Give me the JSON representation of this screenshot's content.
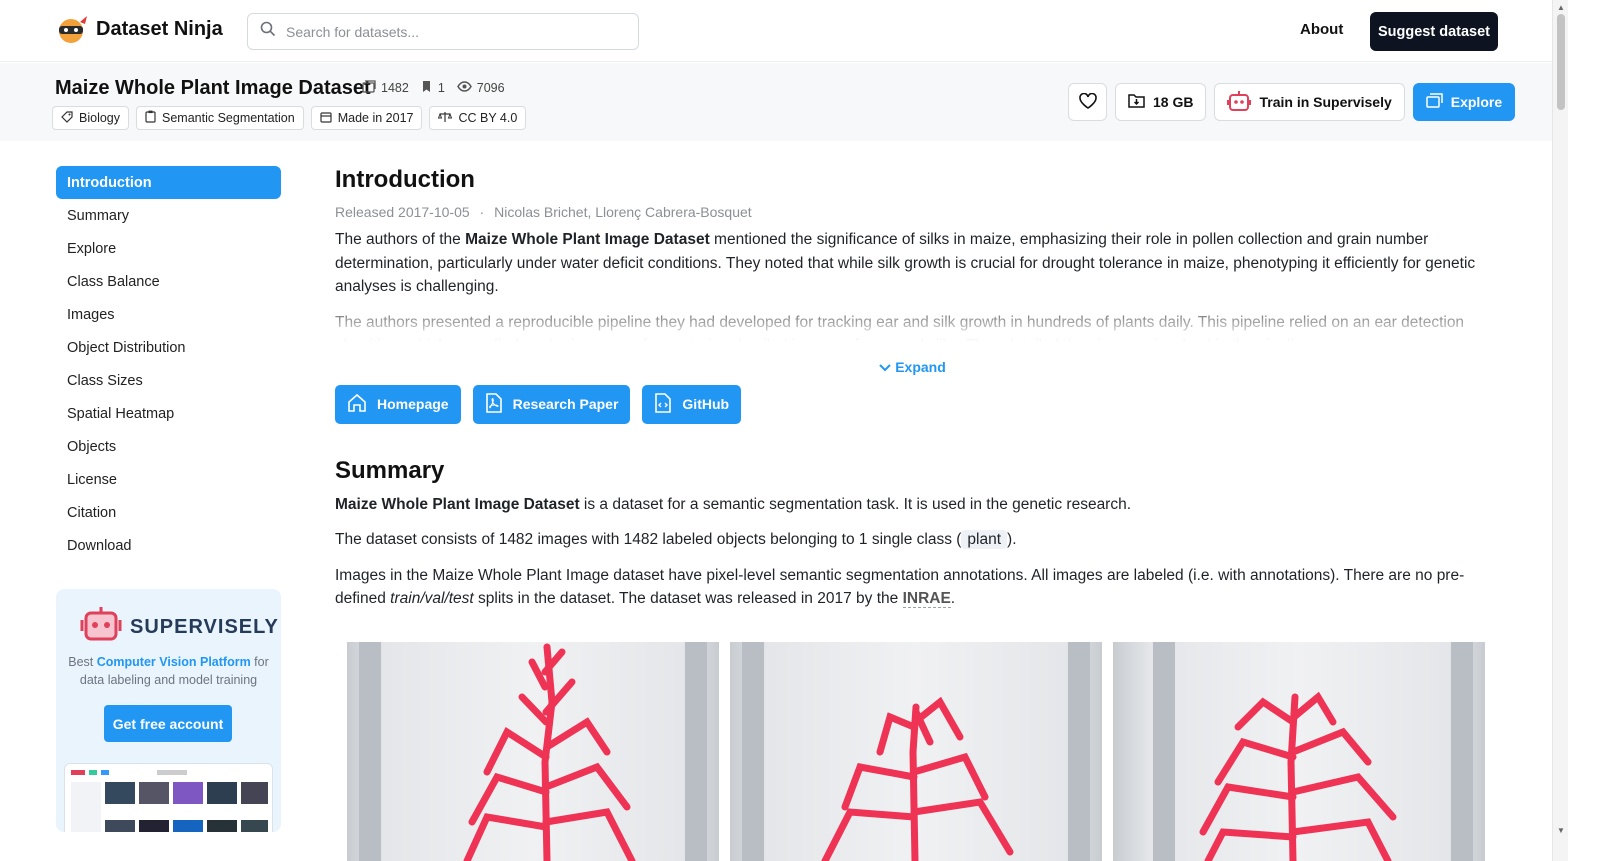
{
  "nav": {
    "logo_text": "Dataset Ninja",
    "search_placeholder": "Search for datasets...",
    "about": "About",
    "suggest": "Suggest dataset"
  },
  "dataset": {
    "title": "Maize Whole Plant Image Dataset",
    "images_count": "1482",
    "classes_count": "1",
    "views_count": "7096",
    "tags": [
      {
        "icon": "tag-icon",
        "label": "Biology"
      },
      {
        "icon": "clipboard-icon",
        "label": "Semantic Segmentation"
      },
      {
        "icon": "calendar-icon",
        "label": "Made in 2017"
      },
      {
        "icon": "scale-icon",
        "label": "CC BY 4.0"
      }
    ],
    "actions": {
      "size": "18 GB",
      "train": "Train in Supervisely",
      "explore": "Explore"
    }
  },
  "sidebar": {
    "items": [
      "Introduction",
      "Summary",
      "Explore",
      "Class Balance",
      "Images",
      "Object Distribution",
      "Class Sizes",
      "Spatial Heatmap",
      "Objects",
      "License",
      "Citation",
      "Download"
    ],
    "active_index": 0
  },
  "promo": {
    "brand": "SUPERVISELY",
    "text_prefix": "Best ",
    "text_link": "Computer Vision Platform",
    "text_suffix": " for data labeling and model training",
    "button": "Get free account"
  },
  "intro": {
    "heading": "Introduction",
    "released": "Released 2017-10-05",
    "separator": "·",
    "authors": "Nicolas Brichet, Llorenç Cabrera-Bosquet",
    "p1_prefix": "The authors of the ",
    "p1_bold": "Maize Whole Plant Image Dataset",
    "p1_suffix": " mentioned the significance of silks in maize, emphasizing their role in pollen collection and grain number determination, particularly under water deficit conditions. They noted that while silk growth is crucial for drought tolerance in maize, phenotyping it efficiently for genetic analyses is challenging.",
    "p2": "The authors presented a reproducible pipeline they had developed for tracking ear and silk growth in hundreds of plants daily. This pipeline relied on an ear detection algorithm, which controlled a robotic camera for capturing detailed images of ears and silks. They detailed the six steps involved in the pipeline:",
    "expand": "Expand",
    "links": [
      "Homepage",
      "Research Paper",
      "GitHub"
    ]
  },
  "summary": {
    "heading": "Summary",
    "s1_bold": "Maize Whole Plant Image Dataset",
    "s1_rest": " is a dataset for a semantic segmentation task. It is used in the genetic research.",
    "s2_prefix": "The dataset consists of 1482 images with 1482 labeled objects belonging to 1 single class (",
    "s2_class": "plant",
    "s2_suffix": ").",
    "s3_prefix": "Images in the Maize Whole Plant Image dataset have pixel-level semantic segmentation annotations. All images are labeled (i.e. with annotations). There are no pre-defined ",
    "s3_italic": "train/val/test",
    "s3_mid": " splits in the dataset. The dataset was released in 2017 by the ",
    "s3_org": "INRAE",
    "s3_end": "."
  },
  "colors": {
    "accent": "#2196f3",
    "dark_button": "#0d1321",
    "mask": "#ee3355"
  }
}
